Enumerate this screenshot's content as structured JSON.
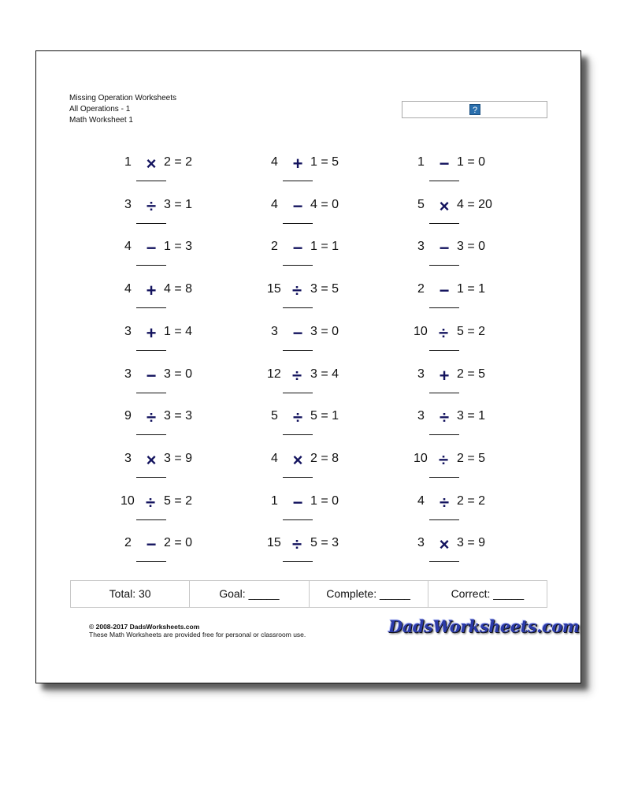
{
  "header": {
    "line1": "Missing Operation Worksheets",
    "line2": "All Operations - 1",
    "line3": "Math Worksheet 1"
  },
  "name_box": {
    "help_icon": "?"
  },
  "problems": [
    [
      {
        "a": "1",
        "op": "×",
        "b": "2",
        "result": "2"
      },
      {
        "a": "3",
        "op": "÷",
        "b": "3",
        "result": "1"
      },
      {
        "a": "4",
        "op": "−",
        "b": "1",
        "result": "3"
      },
      {
        "a": "4",
        "op": "+",
        "b": "4",
        "result": "8"
      },
      {
        "a": "3",
        "op": "+",
        "b": "1",
        "result": "4"
      },
      {
        "a": "3",
        "op": "−",
        "b": "3",
        "result": "0"
      },
      {
        "a": "9",
        "op": "÷",
        "b": "3",
        "result": "3"
      },
      {
        "a": "3",
        "op": "×",
        "b": "3",
        "result": "9"
      },
      {
        "a": "10",
        "op": "÷",
        "b": "5",
        "result": "2"
      },
      {
        "a": "2",
        "op": "−",
        "b": "2",
        "result": "0"
      }
    ],
    [
      {
        "a": "4",
        "op": "+",
        "b": "1",
        "result": "5"
      },
      {
        "a": "4",
        "op": "−",
        "b": "4",
        "result": "0"
      },
      {
        "a": "2",
        "op": "−",
        "b": "1",
        "result": "1"
      },
      {
        "a": "15",
        "op": "÷",
        "b": "3",
        "result": "5"
      },
      {
        "a": "3",
        "op": "−",
        "b": "3",
        "result": "0"
      },
      {
        "a": "12",
        "op": "÷",
        "b": "3",
        "result": "4"
      },
      {
        "a": "5",
        "op": "÷",
        "b": "5",
        "result": "1"
      },
      {
        "a": "4",
        "op": "×",
        "b": "2",
        "result": "8"
      },
      {
        "a": "1",
        "op": "−",
        "b": "1",
        "result": "0"
      },
      {
        "a": "15",
        "op": "÷",
        "b": "5",
        "result": "3"
      }
    ],
    [
      {
        "a": "1",
        "op": "−",
        "b": "1",
        "result": "0"
      },
      {
        "a": "5",
        "op": "×",
        "b": "4",
        "result": "20"
      },
      {
        "a": "3",
        "op": "−",
        "b": "3",
        "result": "0"
      },
      {
        "a": "2",
        "op": "−",
        "b": "1",
        "result": "1"
      },
      {
        "a": "10",
        "op": "÷",
        "b": "5",
        "result": "2"
      },
      {
        "a": "3",
        "op": "+",
        "b": "2",
        "result": "5"
      },
      {
        "a": "3",
        "op": "÷",
        "b": "3",
        "result": "1"
      },
      {
        "a": "10",
        "op": "÷",
        "b": "2",
        "result": "5"
      },
      {
        "a": "4",
        "op": "÷",
        "b": "2",
        "result": "2"
      },
      {
        "a": "3",
        "op": "×",
        "b": "3",
        "result": "9"
      }
    ]
  ],
  "stats": {
    "total": "Total: 30",
    "goal": "Goal: _____",
    "complete": "Complete: _____",
    "correct": "Correct: _____"
  },
  "footer": {
    "copyright": "© 2008-2017 DadsWorksheets.com",
    "notice": "These Math Worksheets are provided free for personal or classroom use.",
    "logo": "DadsWorksheets.com"
  }
}
